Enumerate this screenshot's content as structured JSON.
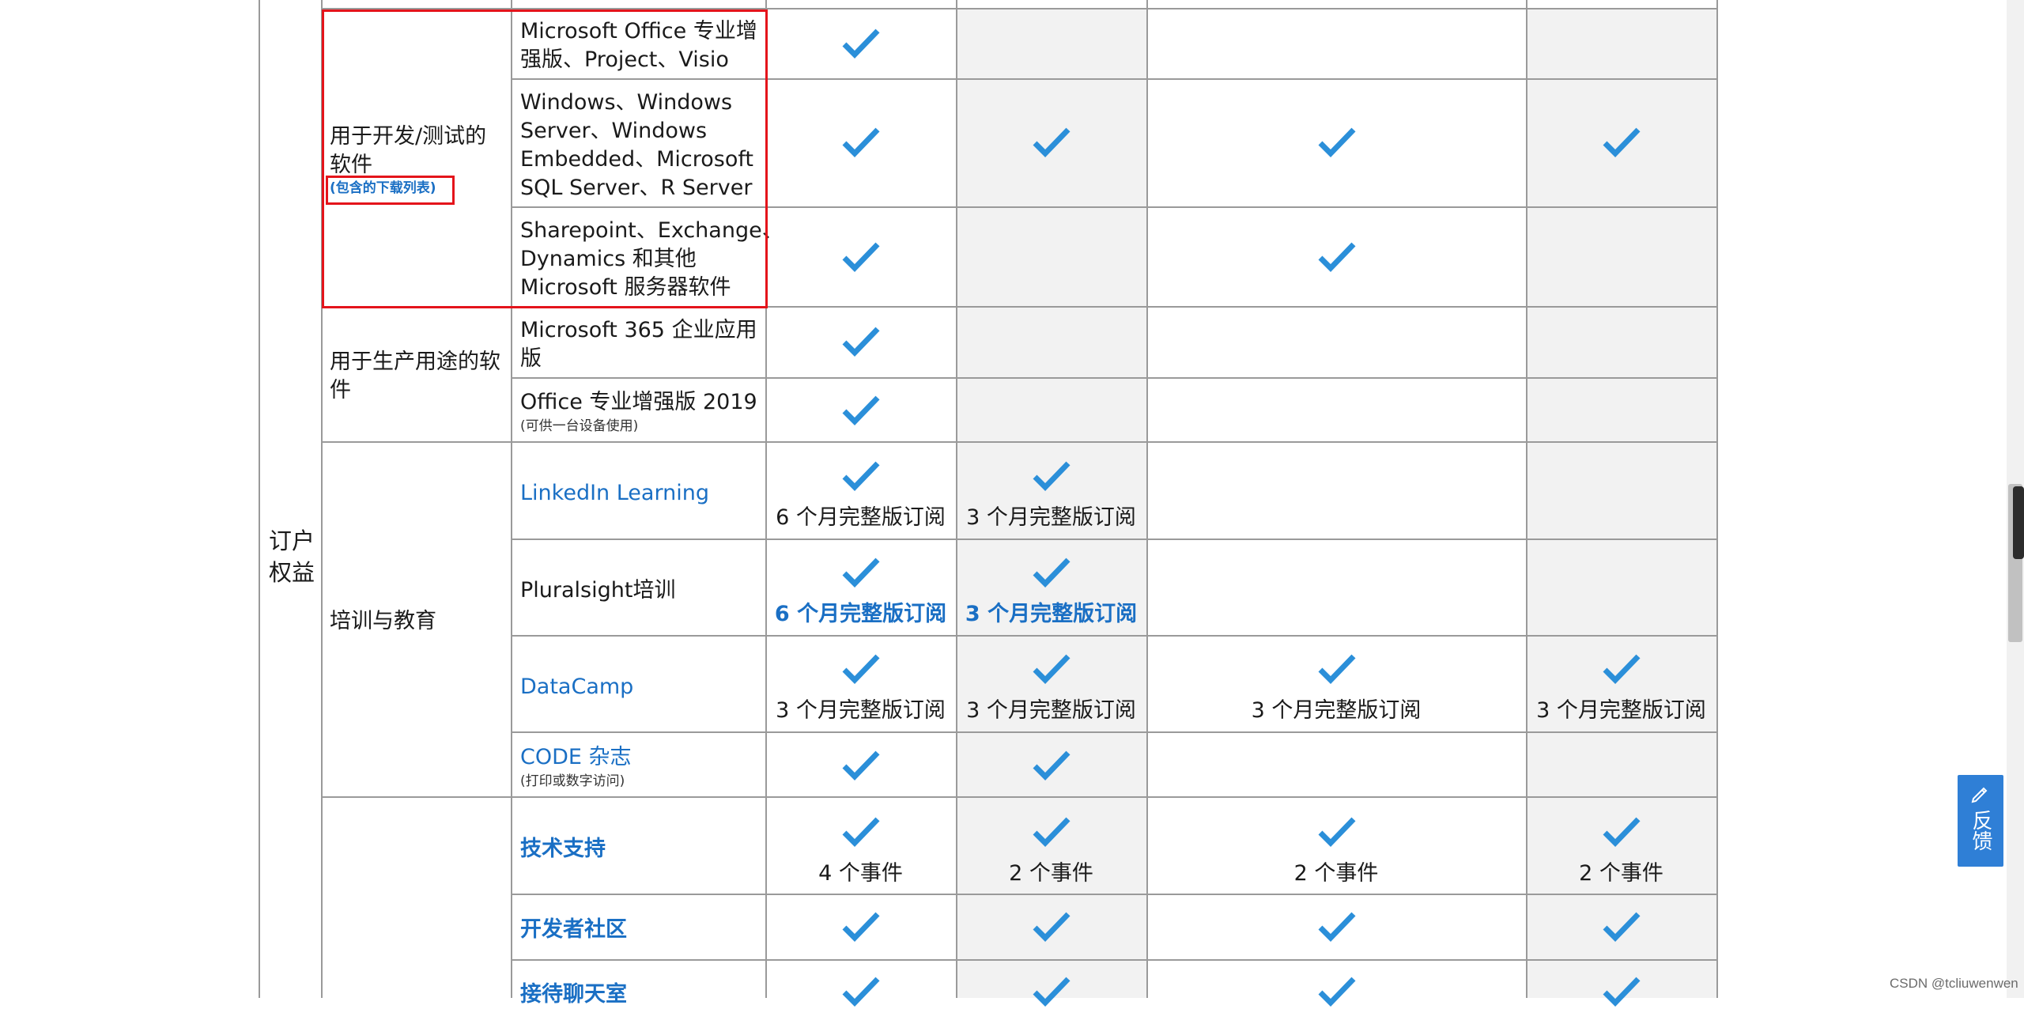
{
  "table": {
    "section_label": "订户\n权益",
    "groups": [
      {
        "label": "用于开发/测试的\n软件",
        "link": "(包含的下载列表)"
      },
      {
        "label": "用于生产用途的软\n件"
      },
      {
        "label": "培训与教育"
      },
      {
        "label": ""
      }
    ],
    "rows": [
      {
        "name": "Microsoft Office 专业增\n强版、Project、Visio"
      },
      {
        "name": "Windows、Windows\nServer、Windows\nEmbedded、Microsoft\nSQL Server、R Server"
      },
      {
        "name": "Sharepoint、Exchange、\nDynamics 和其他\nMicrosoft 服务器软件"
      },
      {
        "name": "Microsoft 365 企业应用\n版"
      },
      {
        "name": "Office 专业增强版 2019",
        "note": "(可供一台设备使用)"
      },
      {
        "name": "LinkedIn Learning",
        "sub": [
          "6 个月完整版订阅",
          "3 个月完整版订阅"
        ]
      },
      {
        "name": "Pluralsight培训",
        "sub": [
          "6 个月完整版订阅",
          "3 个月完整版订阅"
        ]
      },
      {
        "name": "DataCamp",
        "sub": [
          "3 个月完整版订阅",
          "3 个月完整版订阅",
          "3 个月完整版订阅",
          "3 个月完整版订阅"
        ]
      },
      {
        "name": "CODE 杂志",
        "note": "(打印或数字访问)"
      },
      {
        "name": "技术支持",
        "sub": [
          "4 个事件",
          "2 个事件",
          "2 个事件",
          "2 个事件"
        ]
      },
      {
        "name": "开发者社区"
      },
      {
        "name": "接待聊天室"
      }
    ]
  },
  "feedback_label": "反馈",
  "watermark": "CSDN @tcliuwenwen",
  "colors": {
    "accent": "#1a6fc4",
    "check": "#2b8fd9",
    "highlight": "#e4141b",
    "feedback": "#2f7fd6"
  }
}
